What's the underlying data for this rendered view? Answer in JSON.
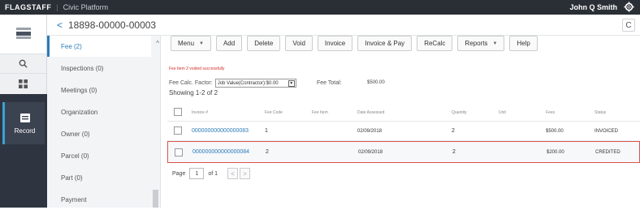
{
  "topbar": {
    "brand": "FLAGSTAFF",
    "product": "Civic Platform",
    "user": "John Q Smith",
    "settings_icon": "gear-icon"
  },
  "rail": {
    "search_icon": "search-icon",
    "apps_icon": "grid-icon",
    "record_label": "Record",
    "record_icon": "record-icon"
  },
  "header": {
    "back_symbol": "<",
    "record_id": "18898-00000-00003",
    "refresh_symbol": "C"
  },
  "subnav": {
    "items": [
      {
        "label": "Fee (2)"
      },
      {
        "label": "Inspections (0)"
      },
      {
        "label": "Meetings (0)"
      },
      {
        "label": "Organization"
      },
      {
        "label": "Owner (0)"
      },
      {
        "label": "Parcel (0)"
      },
      {
        "label": "Part (0)"
      },
      {
        "label": "Payment"
      }
    ],
    "active_index": 0
  },
  "toolbar": {
    "menu": "Menu",
    "add": "Add",
    "delete": "Delete",
    "void": "Void",
    "invoice": "Invoice",
    "invoice_pay": "Invoice & Pay",
    "recalc": "ReCalc",
    "reports": "Reports",
    "help": "Help"
  },
  "fees": {
    "success_message": "Fee Item 2 voided successfully",
    "calc_factor_label": "Fee Calc. Factor:",
    "calc_factor_value": "Job Value(Contractor):$0.00",
    "fee_total_label": "Fee Total:",
    "fee_total_value": "$500.00",
    "showing": "Showing 1-2 of 2",
    "columns": {
      "invoice": "Invoice #",
      "fee_code": "Fee Code",
      "fee_item": "Fee Item",
      "date_assessed": "Date Assessed",
      "quantity": "Quantity",
      "unit": "Unit",
      "fees": "Fees",
      "status": "Status"
    },
    "rows": [
      {
        "invoice": "000000000000000083",
        "fee_code": "1",
        "fee_item": "",
        "date_assessed": "02/09/2018",
        "quantity": "2",
        "unit": "",
        "fees": "$500.00",
        "status": "INVOICED"
      },
      {
        "invoice": "000000000000000084",
        "fee_code": "2",
        "fee_item": "",
        "date_assessed": "02/09/2018",
        "quantity": "2",
        "unit": "",
        "fees": "$200.00",
        "status": "CREDITED"
      }
    ]
  },
  "pager": {
    "page_label": "Page",
    "page_value": "1",
    "of_label": "of 1",
    "prev": "<",
    "next": ">"
  },
  "colors": {
    "accent": "#2b7bb9",
    "topbar": "#2a2f36",
    "highlight_border": "#d9534f"
  }
}
